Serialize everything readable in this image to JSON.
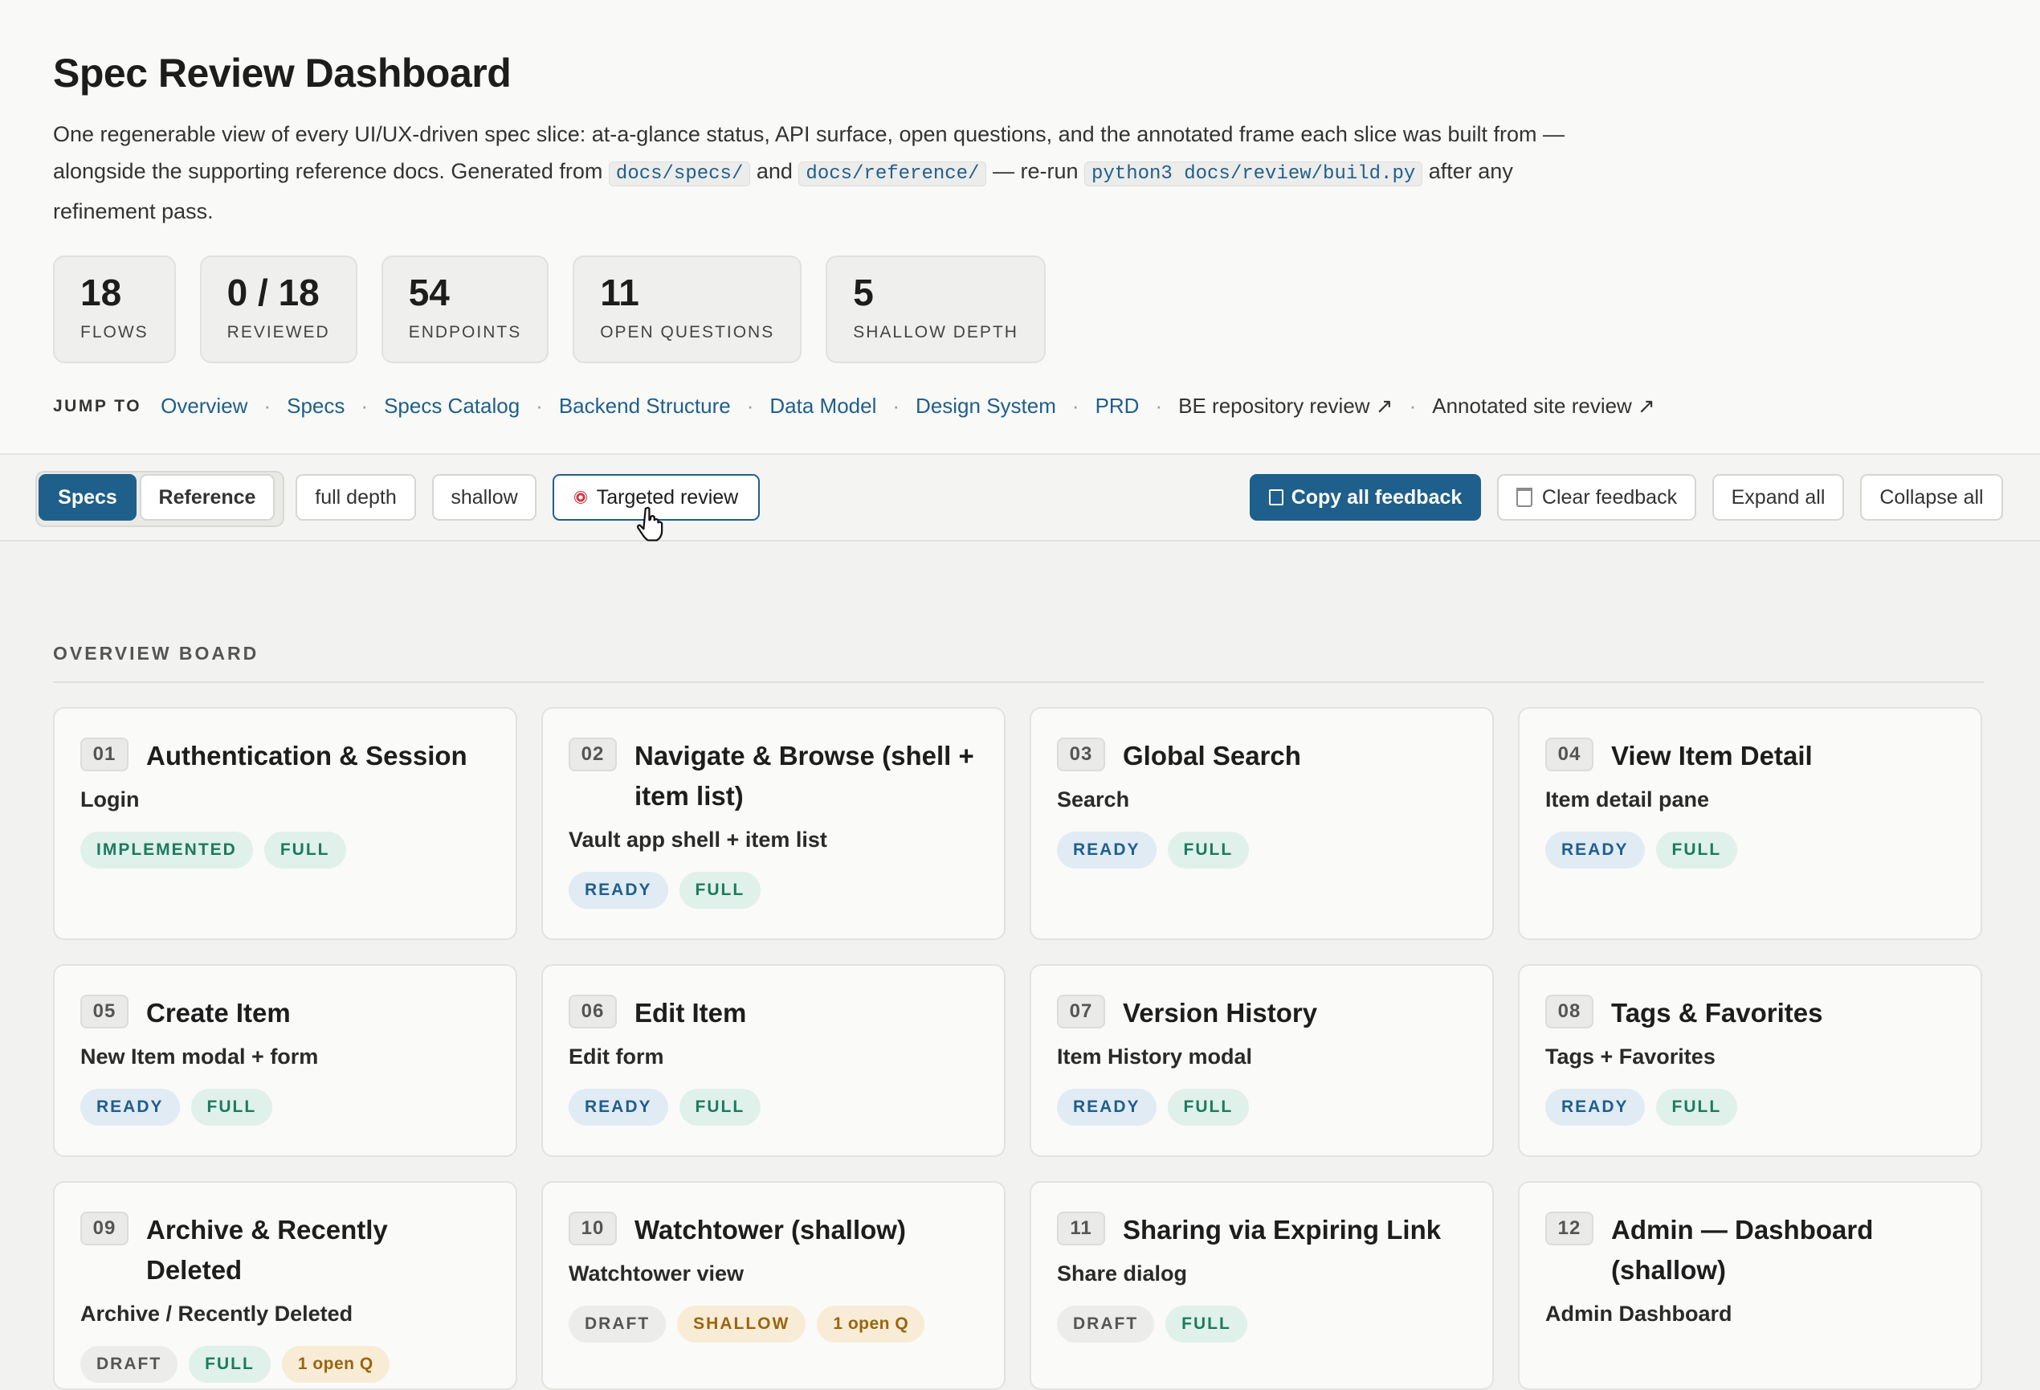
{
  "page": {
    "title": "Spec Review Dashboard",
    "intro": {
      "p1": "One regenerable view of every UI/UX-driven spec slice: at-a-glance status, API surface, open questions, and the annotated frame each slice was built from — alongside the supporting reference docs. Generated from ",
      "code1": "docs/specs/",
      "p2": " and ",
      "code2": "docs/reference/",
      "p3": " — re-run ",
      "code3": "python3 docs/review/build.py",
      "p4": " after any refinement pass."
    }
  },
  "stats": [
    {
      "value": "18",
      "label": "FLOWS"
    },
    {
      "value": "0 / 18",
      "label": "REVIEWED"
    },
    {
      "value": "54",
      "label": "ENDPOINTS"
    },
    {
      "value": "11",
      "label": "OPEN QUESTIONS"
    },
    {
      "value": "5",
      "label": "SHALLOW DEPTH"
    }
  ],
  "jump": {
    "label": "JUMP TO",
    "links": [
      "Overview",
      "Specs",
      "Specs Catalog",
      "Backend Structure",
      "Data Model",
      "Design System",
      "PRD"
    ],
    "external": [
      "BE repository review ↗",
      "Annotated site review ↗"
    ],
    "separator": "·"
  },
  "toolbar": {
    "tabs": [
      "Specs",
      "Reference"
    ],
    "filters": [
      "full depth",
      "shallow",
      "Targeted review"
    ],
    "actions": [
      "Copy all feedback",
      "Clear feedback",
      "Expand all",
      "Collapse all"
    ]
  },
  "section": {
    "label": "OVERVIEW BOARD"
  },
  "cards": [
    {
      "num": "01",
      "title": "Authentication & Session",
      "subtitle": "Login",
      "chips": [
        {
          "text": "IMPLEMENTED",
          "kind": "implemented"
        },
        {
          "text": "FULL",
          "kind": "full"
        }
      ]
    },
    {
      "num": "02",
      "title": "Navigate & Browse (shell + item list)",
      "subtitle": "Vault app shell + item list",
      "chips": [
        {
          "text": "READY",
          "kind": "ready"
        },
        {
          "text": "FULL",
          "kind": "full"
        }
      ]
    },
    {
      "num": "03",
      "title": "Global Search",
      "subtitle": "Search",
      "chips": [
        {
          "text": "READY",
          "kind": "ready"
        },
        {
          "text": "FULL",
          "kind": "full"
        }
      ]
    },
    {
      "num": "04",
      "title": "View Item Detail",
      "subtitle": "Item detail pane",
      "chips": [
        {
          "text": "READY",
          "kind": "ready"
        },
        {
          "text": "FULL",
          "kind": "full"
        }
      ]
    },
    {
      "num": "05",
      "title": "Create Item",
      "subtitle": "New Item modal + form",
      "chips": [
        {
          "text": "READY",
          "kind": "ready"
        },
        {
          "text": "FULL",
          "kind": "full"
        }
      ]
    },
    {
      "num": "06",
      "title": "Edit Item",
      "subtitle": "Edit form",
      "chips": [
        {
          "text": "READY",
          "kind": "ready"
        },
        {
          "text": "FULL",
          "kind": "full"
        }
      ]
    },
    {
      "num": "07",
      "title": "Version History",
      "subtitle": "Item History modal",
      "chips": [
        {
          "text": "READY",
          "kind": "ready"
        },
        {
          "text": "FULL",
          "kind": "full"
        }
      ]
    },
    {
      "num": "08",
      "title": "Tags & Favorites",
      "subtitle": "Tags + Favorites",
      "chips": [
        {
          "text": "READY",
          "kind": "ready"
        },
        {
          "text": "FULL",
          "kind": "full"
        }
      ]
    },
    {
      "num": "09",
      "title": "Archive & Recently Deleted",
      "subtitle": "Archive / Recently Deleted",
      "chips": [
        {
          "text": "DRAFT",
          "kind": "draft"
        },
        {
          "text": "FULL",
          "kind": "full"
        },
        {
          "text": "1 open Q",
          "kind": "openq"
        }
      ]
    },
    {
      "num": "10",
      "title": "Watchtower (shallow)",
      "subtitle": "Watchtower view",
      "chips": [
        {
          "text": "DRAFT",
          "kind": "draft"
        },
        {
          "text": "SHALLOW",
          "kind": "shallow"
        },
        {
          "text": "1 open Q",
          "kind": "openq"
        }
      ]
    },
    {
      "num": "11",
      "title": "Sharing via Expiring Link",
      "subtitle": "Share dialog",
      "chips": [
        {
          "text": "DRAFT",
          "kind": "draft"
        },
        {
          "text": "FULL",
          "kind": "full"
        }
      ]
    },
    {
      "num": "12",
      "title": "Admin — Dashboard (shallow)",
      "subtitle": "Admin Dashboard",
      "chips": []
    }
  ]
}
